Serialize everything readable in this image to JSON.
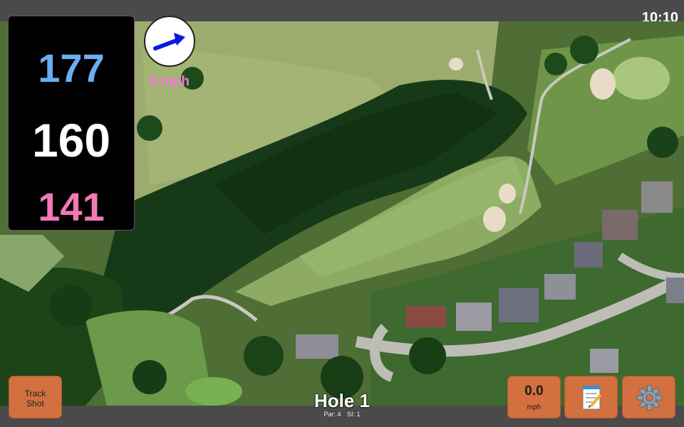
{
  "status": {
    "time": "10:10"
  },
  "distances": {
    "back": "177",
    "middle": "160",
    "front": "141"
  },
  "wind": {
    "speed_label": "8 mph",
    "direction_icon": "arrow-icon"
  },
  "hole": {
    "title": "Hole 1",
    "par": "Par: 4",
    "si": "SI: 1"
  },
  "buttons": {
    "track_shot_line1": "Track",
    "track_shot_line2": "Shot",
    "speed_value": "0.0",
    "speed_unit": "mph",
    "notes_icon": "notepad-icon",
    "settings_icon": "gear-icon"
  },
  "colors": {
    "back": "#6aaef0",
    "middle": "#ffffff",
    "front": "#f279b6",
    "wind_text": "#f279d6",
    "button": "#d2703f"
  }
}
